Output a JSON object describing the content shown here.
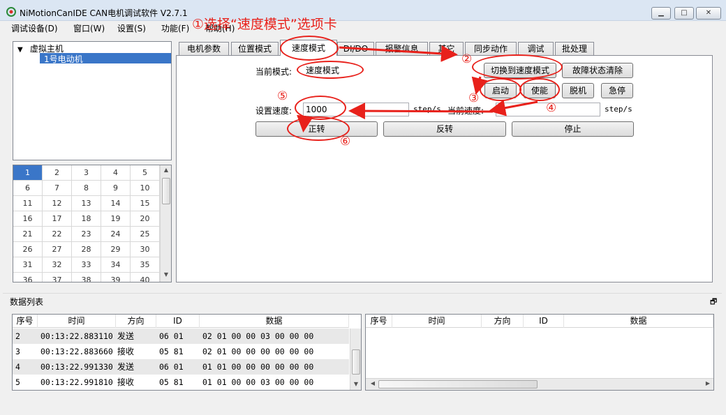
{
  "window": {
    "title": "NiMotionCanIDE CAN电机调试软件 V2.7.1",
    "minimize": "▁",
    "maximize": "□",
    "close": "✕"
  },
  "menu": {
    "items": [
      "调试设备(D)",
      "窗口(W)",
      "设置(S)",
      "功能(F)",
      "帮助(H)"
    ]
  },
  "annotations": {
    "step1": "①选择“速度模式”选项卡",
    "step2": "②",
    "step3": "③",
    "step4": "④",
    "step5": "⑤",
    "step6": "⑥",
    "color": "#e8211b"
  },
  "tree": {
    "root": "虚拟主机",
    "child": "1号电动机",
    "expand_icon": "chevron-down"
  },
  "grid": {
    "selected": "1",
    "cells": [
      "1",
      "2",
      "3",
      "4",
      "5",
      "6",
      "7",
      "8",
      "9",
      "10",
      "11",
      "12",
      "13",
      "14",
      "15",
      "16",
      "17",
      "18",
      "19",
      "20",
      "21",
      "22",
      "23",
      "24",
      "25",
      "26",
      "27",
      "28",
      "29",
      "30",
      "31",
      "32",
      "33",
      "34",
      "35",
      "36",
      "37",
      "38",
      "39",
      "40"
    ]
  },
  "tabs": [
    "电机参数",
    "位置模式",
    "速度模式",
    "DI/DO",
    "报警信息",
    "其它",
    "同步动作",
    "调试",
    "批处理"
  ],
  "active_tab": "速度模式",
  "speed_panel": {
    "current_mode_label": "当前模式:",
    "current_mode_value": "速度模式",
    "switch_button": "切换到速度模式",
    "clear_fault_button": "故障状态清除",
    "start_button": "启动",
    "enable_button": "使能",
    "offline_button": "脱机",
    "estop_button": "急停",
    "set_speed_label": "设置速度:",
    "set_speed_value": "1000",
    "set_speed_unit": "step/s",
    "current_speed_label": "当前速度:",
    "current_speed_value": "",
    "current_speed_unit": "step/s",
    "forward_button": "正转",
    "reverse_button": "反转",
    "stop_button": "停止"
  },
  "datalist": {
    "title": "数据列表",
    "columns": [
      "序号",
      "时间",
      "方向",
      "ID",
      "数据"
    ],
    "rows": [
      [
        "2",
        "00:13:22.883110",
        "发送",
        "06 01",
        "02 01 00 00 03 00 00 00"
      ],
      [
        "3",
        "00:13:22.883660",
        "接收",
        "05 81",
        "02 01 00 00 00 00 00 00"
      ],
      [
        "4",
        "00:13:22.991330",
        "发送",
        "06 01",
        "01 01 00 00 00 00 00 00"
      ],
      [
        "5",
        "00:13:22.991810",
        "接收",
        "05 81",
        "01 01 00 00 03 00 00 00"
      ]
    ],
    "right_columns": [
      "序号",
      "时间",
      "方向",
      "ID",
      "数据"
    ]
  }
}
